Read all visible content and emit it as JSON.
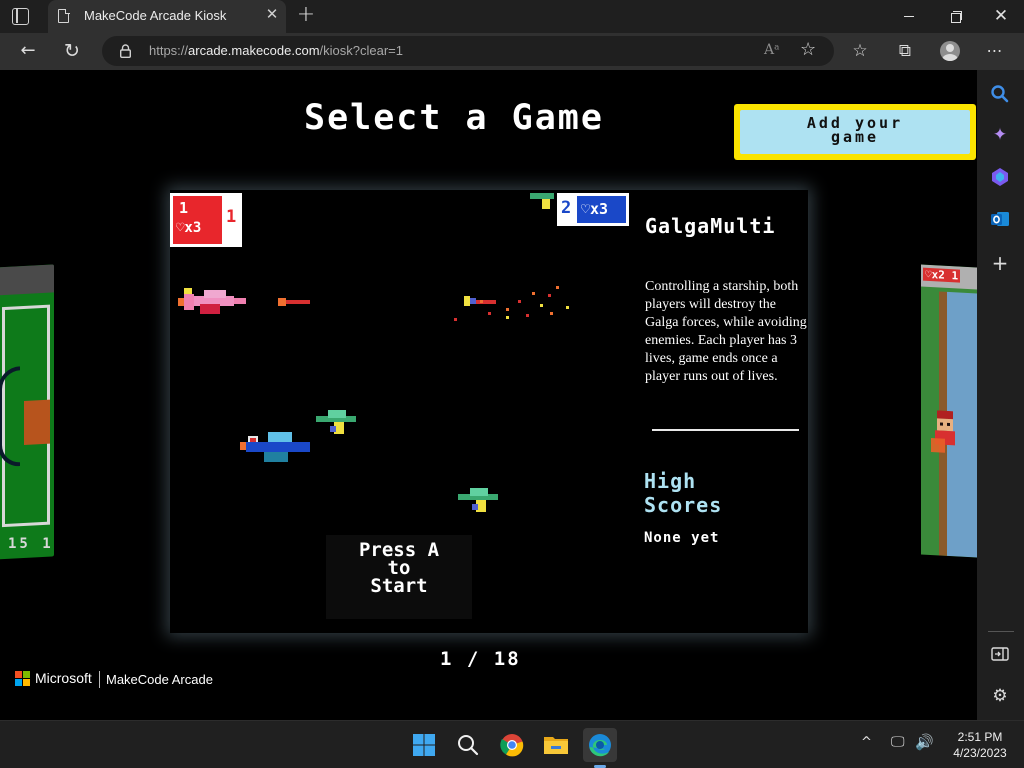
{
  "browser": {
    "tab_title": "MakeCode Arcade Kiosk",
    "url_scheme": "https://",
    "url_host": "arcade.makecode.com",
    "url_path": "/kiosk?clear=1",
    "read_aloud_icon": "Aᵃ",
    "icons": [
      "tab-actions-icon",
      "page-icon",
      "close-icon",
      "plus-icon",
      "minimize-icon",
      "restore-icon",
      "close-icon",
      "back-arrow-icon",
      "refresh-icon",
      "lock-icon",
      "read-aloud-icon",
      "add-favorite-icon",
      "favorites-icon",
      "collections-icon",
      "profile-icon",
      "more-icon"
    ]
  },
  "sidebar": {
    "icons": [
      "search-icon",
      "copilot-icon",
      "games-icon",
      "outlook-icon",
      "plus-icon",
      "hide-sidebar-icon",
      "settings-icon"
    ]
  },
  "kiosk": {
    "title": "Select a Game",
    "add_game_label": "Add your\ngame",
    "left_card_score": "15 1",
    "right_card_lives": "♡x2 1",
    "press_start": "Press A\nto\nStart",
    "pager": "1 / 18",
    "brand_company": "Microsoft",
    "brand_app": "MakeCode Arcade",
    "colors": {
      "accent_yellow": "#fbe400",
      "accent_light_blue": "#aee2f2",
      "player1_red": "#e8262c",
      "player2_blue": "#1a48c8"
    }
  },
  "game": {
    "name": "GalgaMulti",
    "description": "Controlling a starship, both players will destroy the Galga forces, while avoiding enemies. Each player has 3 lives, game ends once a player runs out of lives.",
    "high_scores_label": "High\nScores",
    "high_scores_value": "None yet",
    "player1": {
      "number": "1",
      "lives": "♡x3",
      "score": "1"
    },
    "player2": {
      "number": "2",
      "lives": "♡x3"
    }
  },
  "taskbar": {
    "apps": [
      "windows-start-icon",
      "search-icon",
      "chrome-icon",
      "file-explorer-icon",
      "edge-icon"
    ],
    "tray_chevron": "^",
    "time": "2:51 PM",
    "date": "4/23/2023"
  }
}
